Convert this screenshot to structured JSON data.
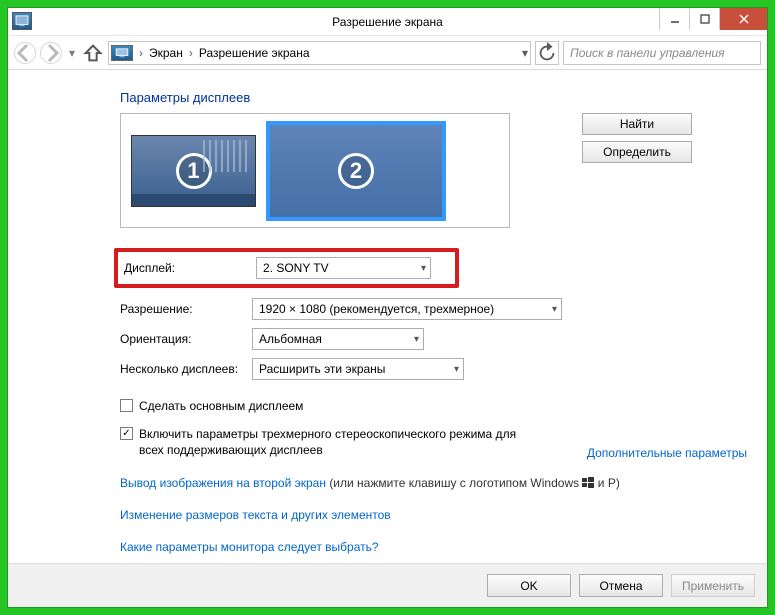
{
  "window": {
    "title": "Разрешение экрана"
  },
  "breadcrumb": {
    "part1": "Экран",
    "part2": "Разрешение экрана"
  },
  "search": {
    "placeholder": "Поиск в панели управления"
  },
  "section_title": "Параметры дисплеев",
  "monitors": {
    "m1": "1",
    "m2": "2"
  },
  "side_buttons": {
    "detect": "Найти",
    "identify": "Определить"
  },
  "form": {
    "display": {
      "label": "Дисплей:",
      "value": "2. SONY TV"
    },
    "resolution": {
      "label": "Разрешение:",
      "value": "1920 × 1080 (рекомендуется, трехмерное)"
    },
    "orientation": {
      "label": "Ориентация:",
      "value": "Альбомная"
    },
    "multiple": {
      "label": "Несколько дисплеев:",
      "value": "Расширить эти экраны"
    }
  },
  "checkboxes": {
    "main_display": "Сделать основным дисплеем",
    "stereo": "Включить параметры трехмерного стереоскопического режима для всех поддерживающих дисплеев"
  },
  "links": {
    "advanced": "Дополнительные параметры",
    "second_screen": "Вывод изображения на второй экран",
    "second_screen_hint": " (или нажмите клавишу с логотипом Windows ",
    "second_screen_hint2": " и P)",
    "text_size": "Изменение размеров текста и других элементов",
    "which_params": "Какие параметры монитора следует выбрать?"
  },
  "buttons": {
    "ok": "OK",
    "cancel": "Отмена",
    "apply": "Применить"
  }
}
